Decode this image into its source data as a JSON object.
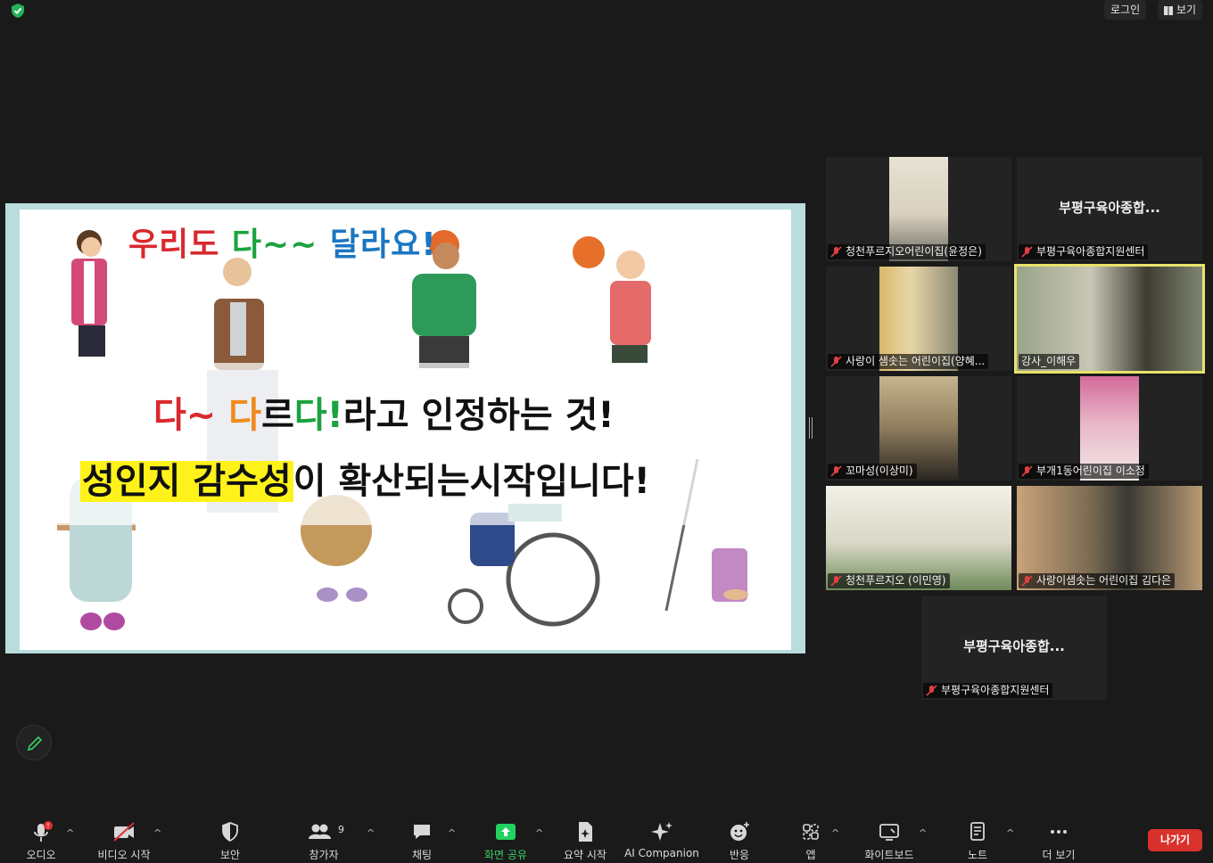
{
  "topbar": {
    "login": "로그인",
    "view": "보기"
  },
  "slide": {
    "title_parts": [
      "우리도 ",
      "다~~ ",
      "달라요!"
    ],
    "line1": {
      "p1": "다~ ",
      "p2": "다",
      "p3": "르",
      "p4": "다!",
      "p5": "라고 인정하는 것!"
    },
    "line2": {
      "highlight": "성인지 감수성",
      "rest": "이 확산되는시작입니다!"
    }
  },
  "gallery": [
    {
      "name": "청천푸르지오어린이집(윤정은)",
      "muted": true,
      "video": true
    },
    {
      "name": "부평구육아종합지원센터",
      "display": "부평구육아종합...",
      "muted": true,
      "video": false
    },
    {
      "name": "사랑이 샘솟는 어린이집(양혜...",
      "muted": true,
      "video": true
    },
    {
      "name": "강사_이해우",
      "muted": false,
      "video": true,
      "active_speaker": true
    },
    {
      "name": "꼬마성(이상미)",
      "muted": true,
      "video": true
    },
    {
      "name": "부개1동어린이집 이소정",
      "muted": true,
      "video": true
    },
    {
      "name": "청천푸르지오 (이민영)",
      "muted": true,
      "video": true
    },
    {
      "name": "사랑이샘솟는 어린이집 김다은",
      "muted": true,
      "video": true
    },
    {
      "name": "부평구육아종합지원센터",
      "display": "부평구육아종합...",
      "muted": true,
      "video": false
    }
  ],
  "toolbar": {
    "audio": "오디오",
    "video": "비디오 시작",
    "security": "보안",
    "participants": "참가자",
    "participants_count": "9",
    "chat": "채팅",
    "share": "화면 공유",
    "summary": "요약 시작",
    "ai": "AI Companion",
    "reactions": "반응",
    "apps": "앱",
    "whiteboard": "화이트보드",
    "notes": "노트",
    "more": "더 보기",
    "leave": "나가기"
  },
  "colors": {
    "accent_green": "#23d160",
    "leave_red": "#d9322d",
    "speaker_outline": "#e8e36a"
  }
}
